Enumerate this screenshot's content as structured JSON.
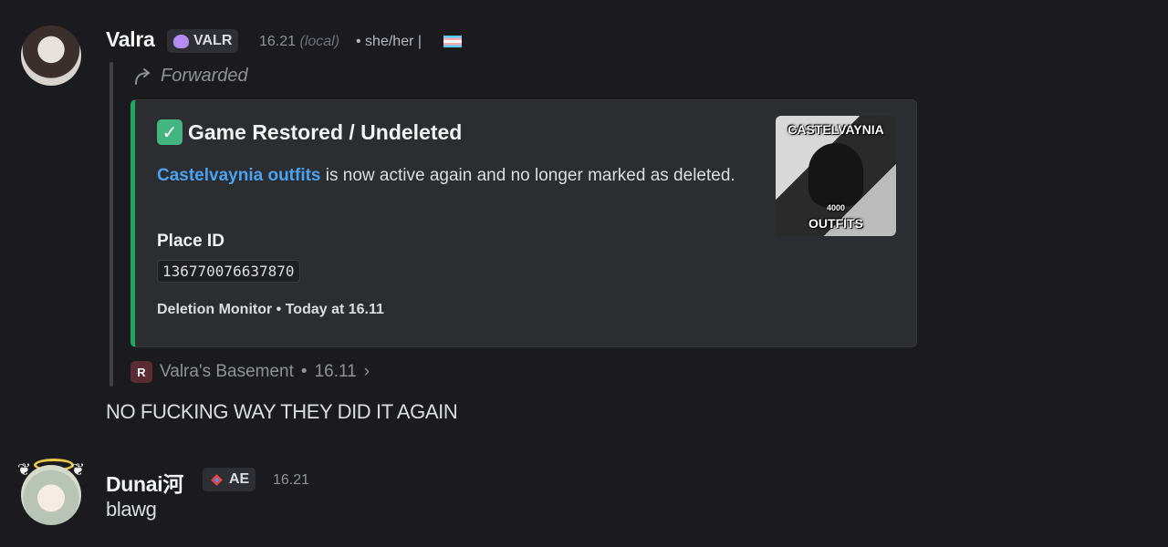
{
  "messages": [
    {
      "author": "Valra",
      "tag": "VALR",
      "time": "16.21",
      "local": "(local)",
      "pronouns": "• she/her |",
      "forwarded_label": "Forwarded",
      "embed": {
        "title": "Game Restored / Undeleted",
        "link_text": "Castelvaynia outfits",
        "desc_rest": " is now active again and no longer marked as deleted.",
        "field_name": "Place ID",
        "field_value": "136770076637870",
        "footer": "Deletion Monitor • Today at 16.11",
        "thumb_top": "CASTELVAYNIA",
        "thumb_mid": "4000",
        "thumb_bottom": "OUTFITS"
      },
      "source": {
        "icon_text": "R",
        "server": "Valra's Basement",
        "sep": "•",
        "time": "16.11",
        "chevron": "›"
      },
      "text": "NO FUCKING WAY THEY DID IT AGAIN"
    },
    {
      "author": "Dunai河",
      "tag": "AE",
      "time": "16.21",
      "text": "blawg"
    }
  ],
  "colors": {
    "background": "#1b1b1f",
    "embed_accent": "#23a55a",
    "link": "#4aa3f0",
    "tag_valr_icon": "#b48cf2"
  },
  "icons": {
    "forward": "forward-arrow-icon",
    "check": "check-mark-icon",
    "tag_valr": "purple-heart-icon",
    "tag_ae": "diamond-logo-icon",
    "flag": "trans-flag-icon"
  }
}
